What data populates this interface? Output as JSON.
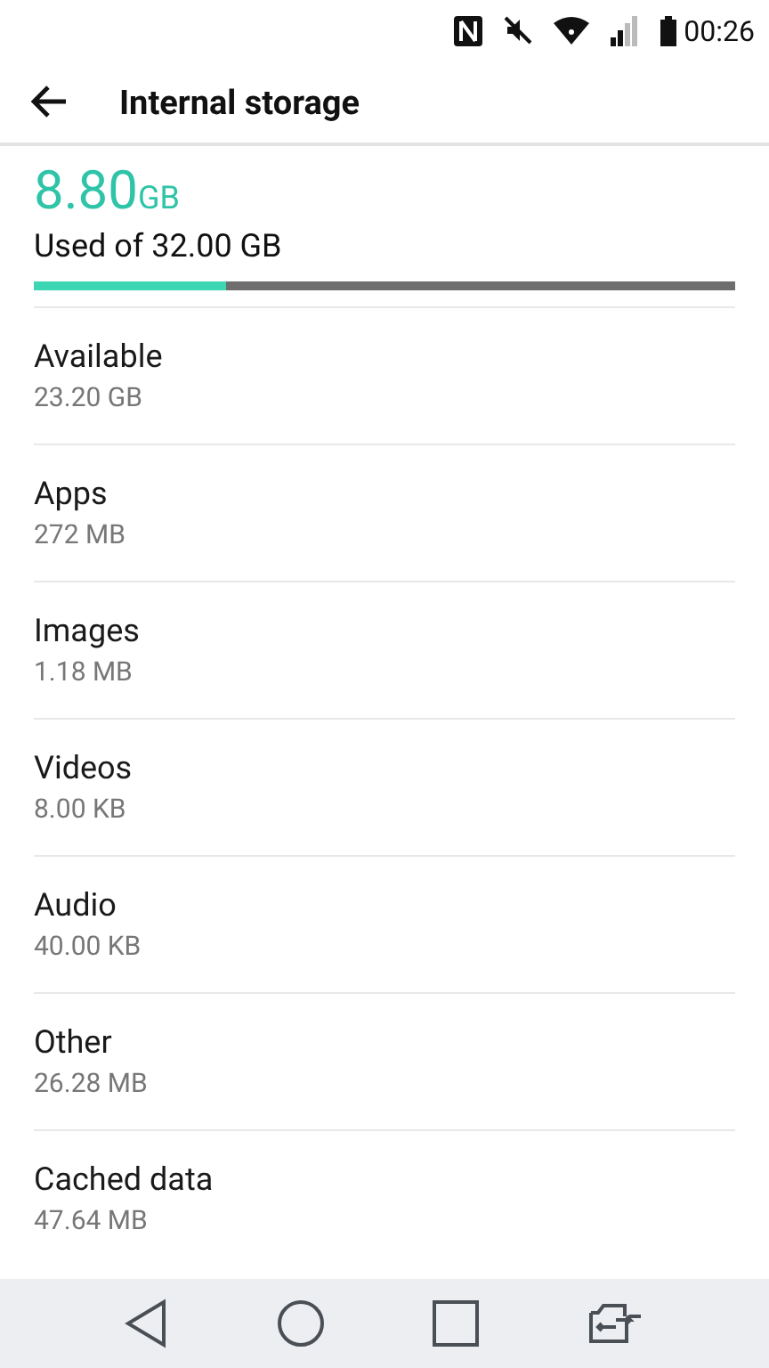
{
  "status_bar": {
    "time": "00:26"
  },
  "app_bar": {
    "title": "Internal storage"
  },
  "usage": {
    "amount": "8.80",
    "unit": "GB",
    "caption": "Used of 32.00 GB",
    "level": 0.275
  },
  "items": [
    {
      "label": "Available",
      "value": "23.20 GB"
    },
    {
      "label": "Apps",
      "value": "272 MB"
    },
    {
      "label": "Images",
      "value": "1.18 MB"
    },
    {
      "label": "Videos",
      "value": "8.00 KB"
    },
    {
      "label": "Audio",
      "value": "40.00 KB"
    },
    {
      "label": "Other",
      "value": "26.28 MB"
    },
    {
      "label": "Cached data",
      "value": "47.64 MB"
    }
  ]
}
